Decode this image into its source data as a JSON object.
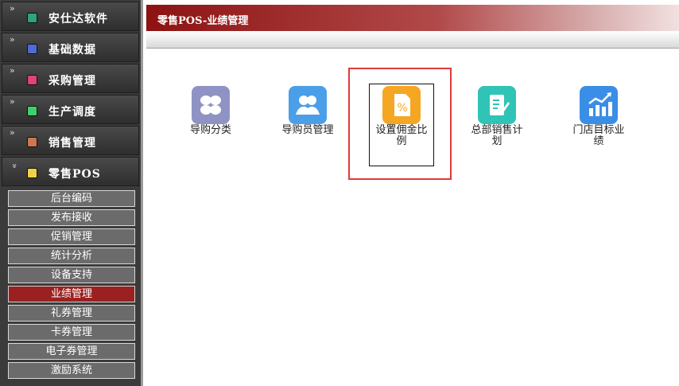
{
  "sidebar": {
    "categories": [
      {
        "label": "安仕达软件",
        "icon_color": "#2fa37a",
        "chev": "»"
      },
      {
        "label": "基础数据",
        "icon_color": "#4f69d6",
        "chev": "»"
      },
      {
        "label": "采购管理",
        "icon_color": "#e0427a",
        "chev": "»"
      },
      {
        "label": "生产调度",
        "icon_color": "#3fcf6a",
        "chev": "»"
      },
      {
        "label": "销售管理",
        "icon_color": "#c9784f",
        "chev": "»"
      },
      {
        "label": "零售POS",
        "icon_color": "#f2d14a",
        "chev": "»"
      }
    ],
    "submenu": [
      {
        "label": "后台编码"
      },
      {
        "label": "发布接收"
      },
      {
        "label": "促销管理"
      },
      {
        "label": "统计分析"
      },
      {
        "label": "设备支持"
      },
      {
        "label": "业绩管理",
        "active": true
      },
      {
        "label": "礼券管理"
      },
      {
        "label": "卡券管理"
      },
      {
        "label": "电子券管理"
      },
      {
        "label": "激励系统"
      }
    ]
  },
  "header": {
    "title": "零售POS-业绩管理"
  },
  "apps": [
    {
      "label": "导购分类",
      "color": "#8f93c4",
      "icon": "four-petal-icon"
    },
    {
      "label": "导购员管理",
      "color": "#4a9fe8",
      "icon": "people-icon"
    },
    {
      "label": "设置佣金比例",
      "color": "#f5a623",
      "icon": "percent-document-icon"
    },
    {
      "label": "总部销售计划",
      "color": "#2fc4b5",
      "icon": "notebook-pen-icon"
    },
    {
      "label": "门店目标业绩",
      "color": "#3a8ee6",
      "icon": "bar-chart-icon"
    }
  ]
}
